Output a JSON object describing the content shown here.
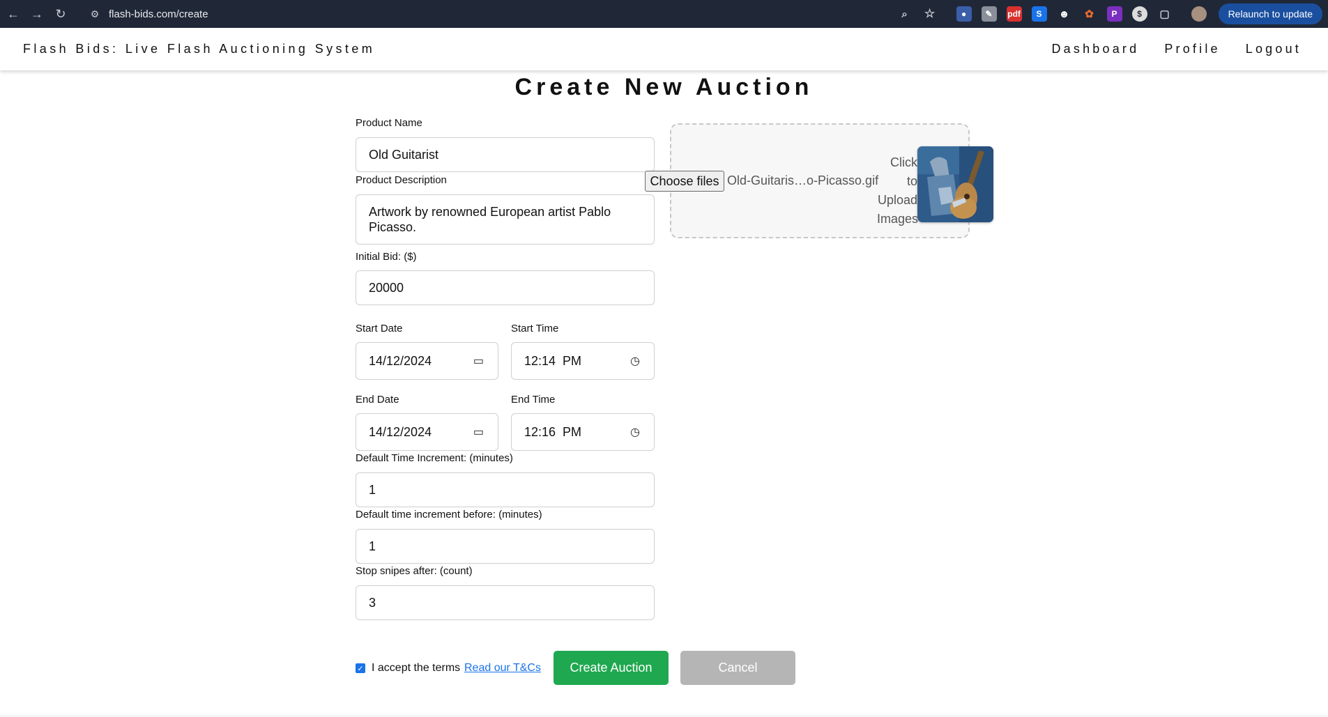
{
  "browser": {
    "url": "flash-bids.com/create",
    "relaunch_label": "Relaunch to update"
  },
  "header": {
    "brand": "Flash Bids: Live Flash Auctioning System",
    "nav": [
      "Dashboard",
      "Profile",
      "Logout"
    ]
  },
  "page": {
    "title": "Create New Auction"
  },
  "form": {
    "product_name": {
      "label": "Product Name",
      "value": "Old Guitarist"
    },
    "product_description": {
      "label": "Product Description",
      "value": "Artwork by renowned European artist Pablo Picasso."
    },
    "initial_bid": {
      "label": "Initial Bid: ($)",
      "value": "20000"
    },
    "start_date": {
      "label": "Start Date",
      "value": "14/12/2024"
    },
    "start_time": {
      "label": "Start Time",
      "value": "12:14  PM"
    },
    "end_date": {
      "label": "End Date",
      "value": "14/12/2024"
    },
    "end_time": {
      "label": "End Time",
      "value": "12:16  PM"
    },
    "time_increment": {
      "label": "Default Time Increment: (minutes)",
      "value": "1"
    },
    "increment_before": {
      "label": "Default time increment before: (minutes)",
      "value": "1"
    },
    "stop_snipes": {
      "label": "Stop snipes after: (count)",
      "value": "3"
    },
    "upload": {
      "choose_label": "Choose files",
      "file_name": "Old-Guitaris…o-Picasso.gif",
      "hint": "Click to Upload Images"
    },
    "terms": {
      "checked": true,
      "label": "I accept the terms",
      "link": "Read our T&Cs"
    },
    "buttons": {
      "create": "Create Auction",
      "cancel": "Cancel"
    }
  },
  "colors": {
    "create_button": "#1fa84f",
    "cancel_button": "#b5b5b5",
    "link": "#1a73e8",
    "chrome_bg": "#202838"
  }
}
